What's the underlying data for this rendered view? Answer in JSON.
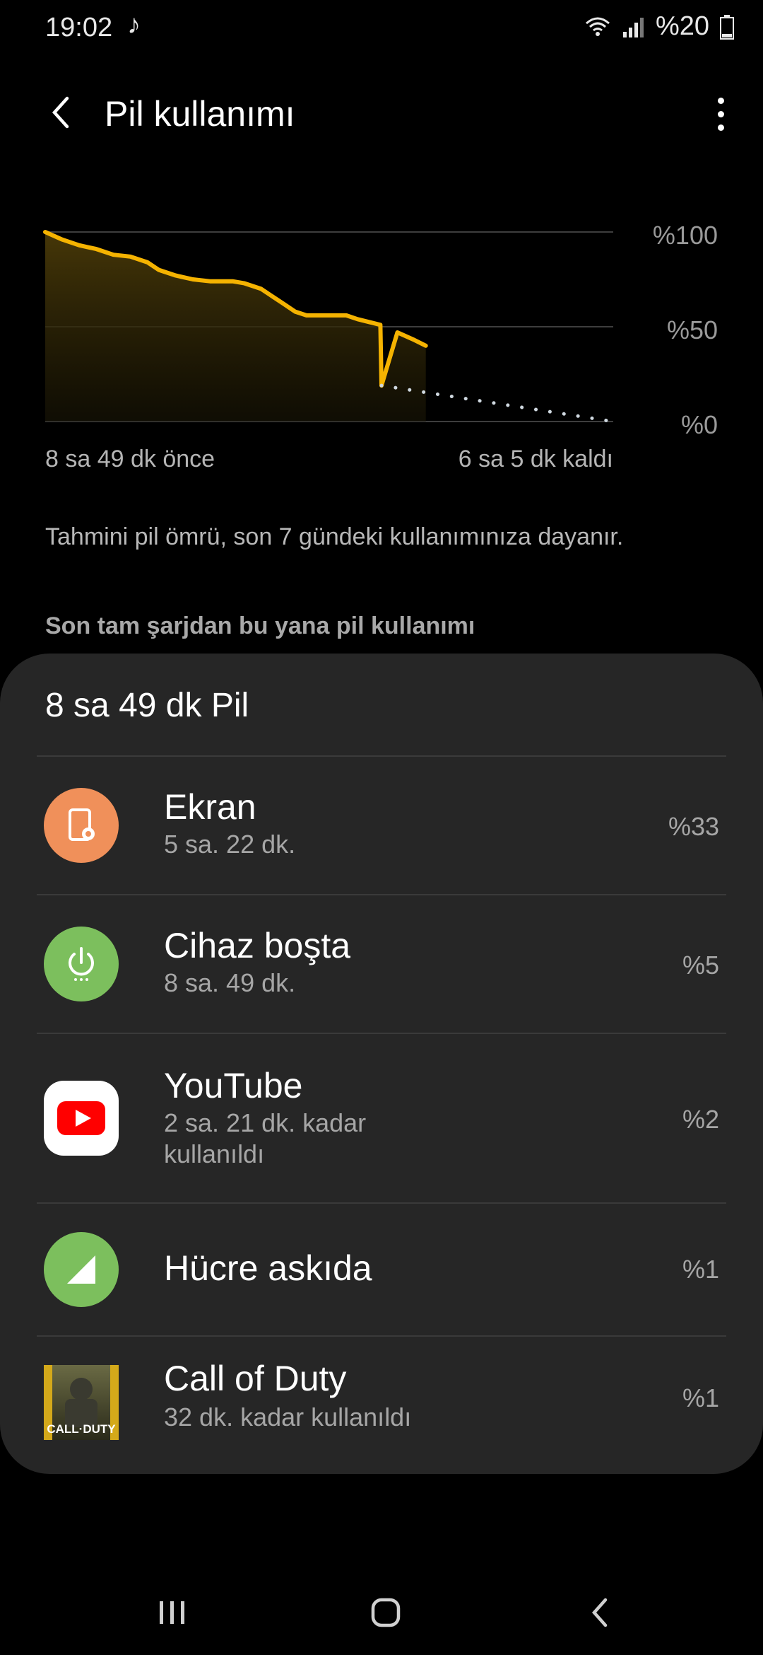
{
  "status_bar": {
    "time": "19:02",
    "battery": "%20"
  },
  "app_bar": {
    "title": "Pil kullanımı"
  },
  "chart_data": {
    "type": "line",
    "y_tick_labels": [
      "%100",
      "%50",
      "%0"
    ],
    "x_start_label": "8 sa 49 dk önce",
    "x_end_label": "6 sa 5 dk kaldı",
    "ylim": [
      0,
      100
    ],
    "history": [
      [
        0,
        100
      ],
      [
        3,
        96
      ],
      [
        6,
        93
      ],
      [
        9,
        91
      ],
      [
        12,
        88
      ],
      [
        15,
        87
      ],
      [
        18,
        84
      ],
      [
        20,
        80
      ],
      [
        23,
        77
      ],
      [
        26,
        75
      ],
      [
        29,
        74
      ],
      [
        33,
        74
      ],
      [
        35,
        73
      ],
      [
        38,
        70
      ],
      [
        40,
        66
      ],
      [
        42,
        62
      ],
      [
        44,
        58
      ],
      [
        46,
        56
      ],
      [
        49,
        56
      ],
      [
        53,
        56
      ],
      [
        55,
        54
      ],
      [
        59,
        51
      ],
      [
        62,
        47
      ],
      [
        65,
        43
      ],
      [
        67,
        40
      ],
      [
        59.2,
        19
      ]
    ],
    "projection": [
      [
        59.2,
        19
      ],
      [
        100,
        0
      ]
    ],
    "colors": {
      "line": "#f5b301",
      "projection": "#cfd8e0"
    }
  },
  "estimate_note": "Tahmini pil ömrü, son 7 gündeki kullanımınıza dayanır.",
  "section_header": "Son tam şarjdan bu yana pil kullanımı",
  "usage_card": {
    "title": "8 sa 49 dk Pil",
    "items": [
      {
        "name": "Ekran",
        "sub": "5 sa. 22 dk.",
        "percent": "%33",
        "icon": "screen-brightness-icon",
        "color": "#f0905a"
      },
      {
        "name": "Cihaz boşta",
        "sub": "8 sa. 49 dk.",
        "percent": "%5",
        "icon": "power-idle-icon",
        "color": "#7cbf5d"
      },
      {
        "name": "YouTube",
        "sub": "2 sa. 21 dk. kadar kullanıldı",
        "percent": "%2",
        "icon": "youtube-icon",
        "color": "#ffffff"
      },
      {
        "name": "Hücre askıda",
        "sub": "",
        "percent": "%1",
        "icon": "cell-signal-icon",
        "color": "#7cbf5d"
      },
      {
        "name": "Call of Duty",
        "sub": "32 dk. kadar kullanıldı",
        "percent": "%1",
        "icon": "call-of-duty-icon",
        "color": "#3a3a2a",
        "icon_text": "CALL·DUTY"
      }
    ]
  }
}
